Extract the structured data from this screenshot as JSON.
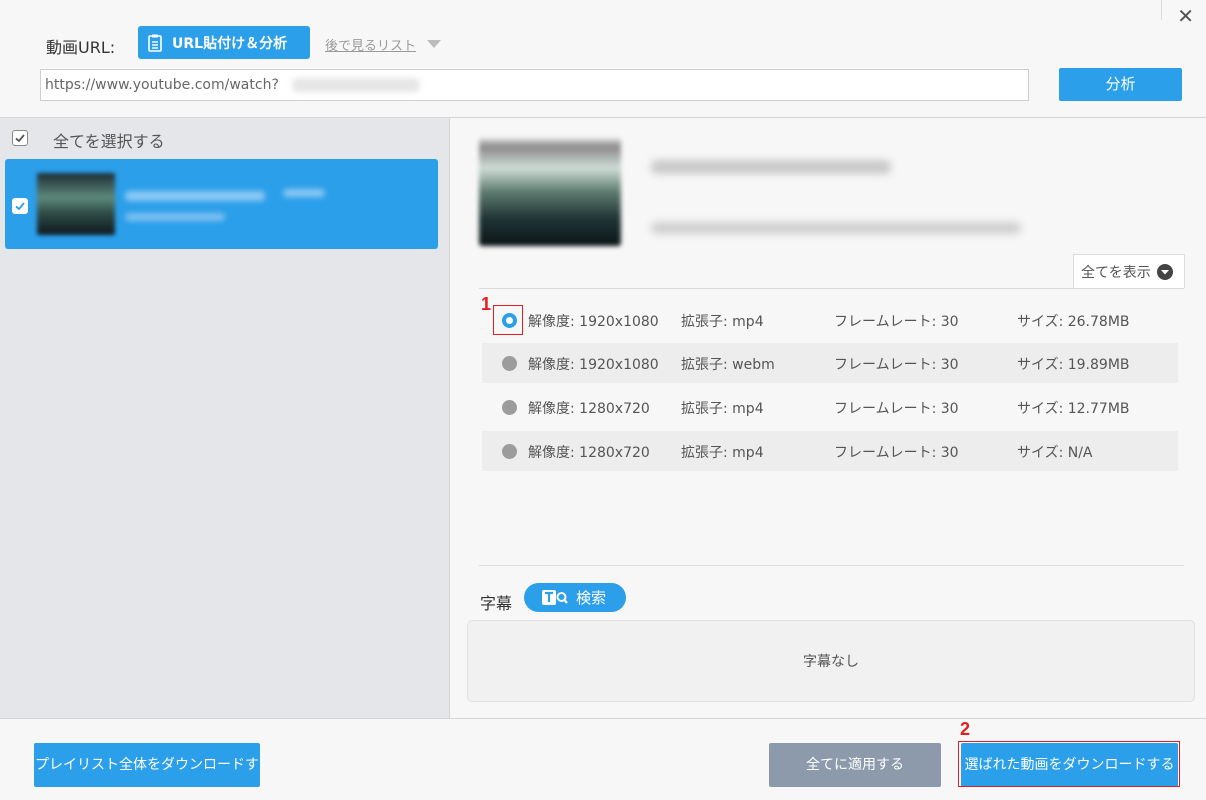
{
  "header": {
    "close_glyph": "✕",
    "url_label": "動画URL:",
    "paste_button": "URL貼付け＆分析",
    "later_list": "後で見るリスト",
    "url_value": "https://www.youtube.com/watch?",
    "analyze_button": "分析"
  },
  "sidebar": {
    "select_all": "全てを選択する"
  },
  "details": {
    "show_all": "全てを表示",
    "formats": [
      {
        "resolution": "解像度: 1920x1080",
        "extension": "拡張子: mp4",
        "framerate": "フレームレート: 30",
        "size": "サイズ: 26.78MB",
        "selected": true
      },
      {
        "resolution": "解像度: 1920x1080",
        "extension": "拡張子: webm",
        "framerate": "フレームレート: 30",
        "size": "サイズ: 19.89MB",
        "selected": false
      },
      {
        "resolution": "解像度: 1280x720",
        "extension": "拡張子: mp4",
        "framerate": "フレームレート: 30",
        "size": "サイズ: 12.77MB",
        "selected": false
      },
      {
        "resolution": "解像度: 1280x720",
        "extension": "拡張子: mp4",
        "framerate": "フレームレート: 30",
        "size": "サイズ: N/A",
        "selected": false
      }
    ],
    "subtitle_label": "字幕",
    "search_button": "検索",
    "no_subtitles": "字幕なし"
  },
  "footer": {
    "playlist_button": "プレイリスト全体をダウンロードする",
    "apply_all_button": "全てに適用する",
    "download_button": "選ばれた動画をダウンロードする"
  },
  "annotations": [
    "1",
    "2"
  ],
  "colors": {
    "accent": "#2b9fea",
    "apply_button": "#8c9aab",
    "annotation": "#e02020",
    "sidebar_bg": "#e4e6ea"
  }
}
